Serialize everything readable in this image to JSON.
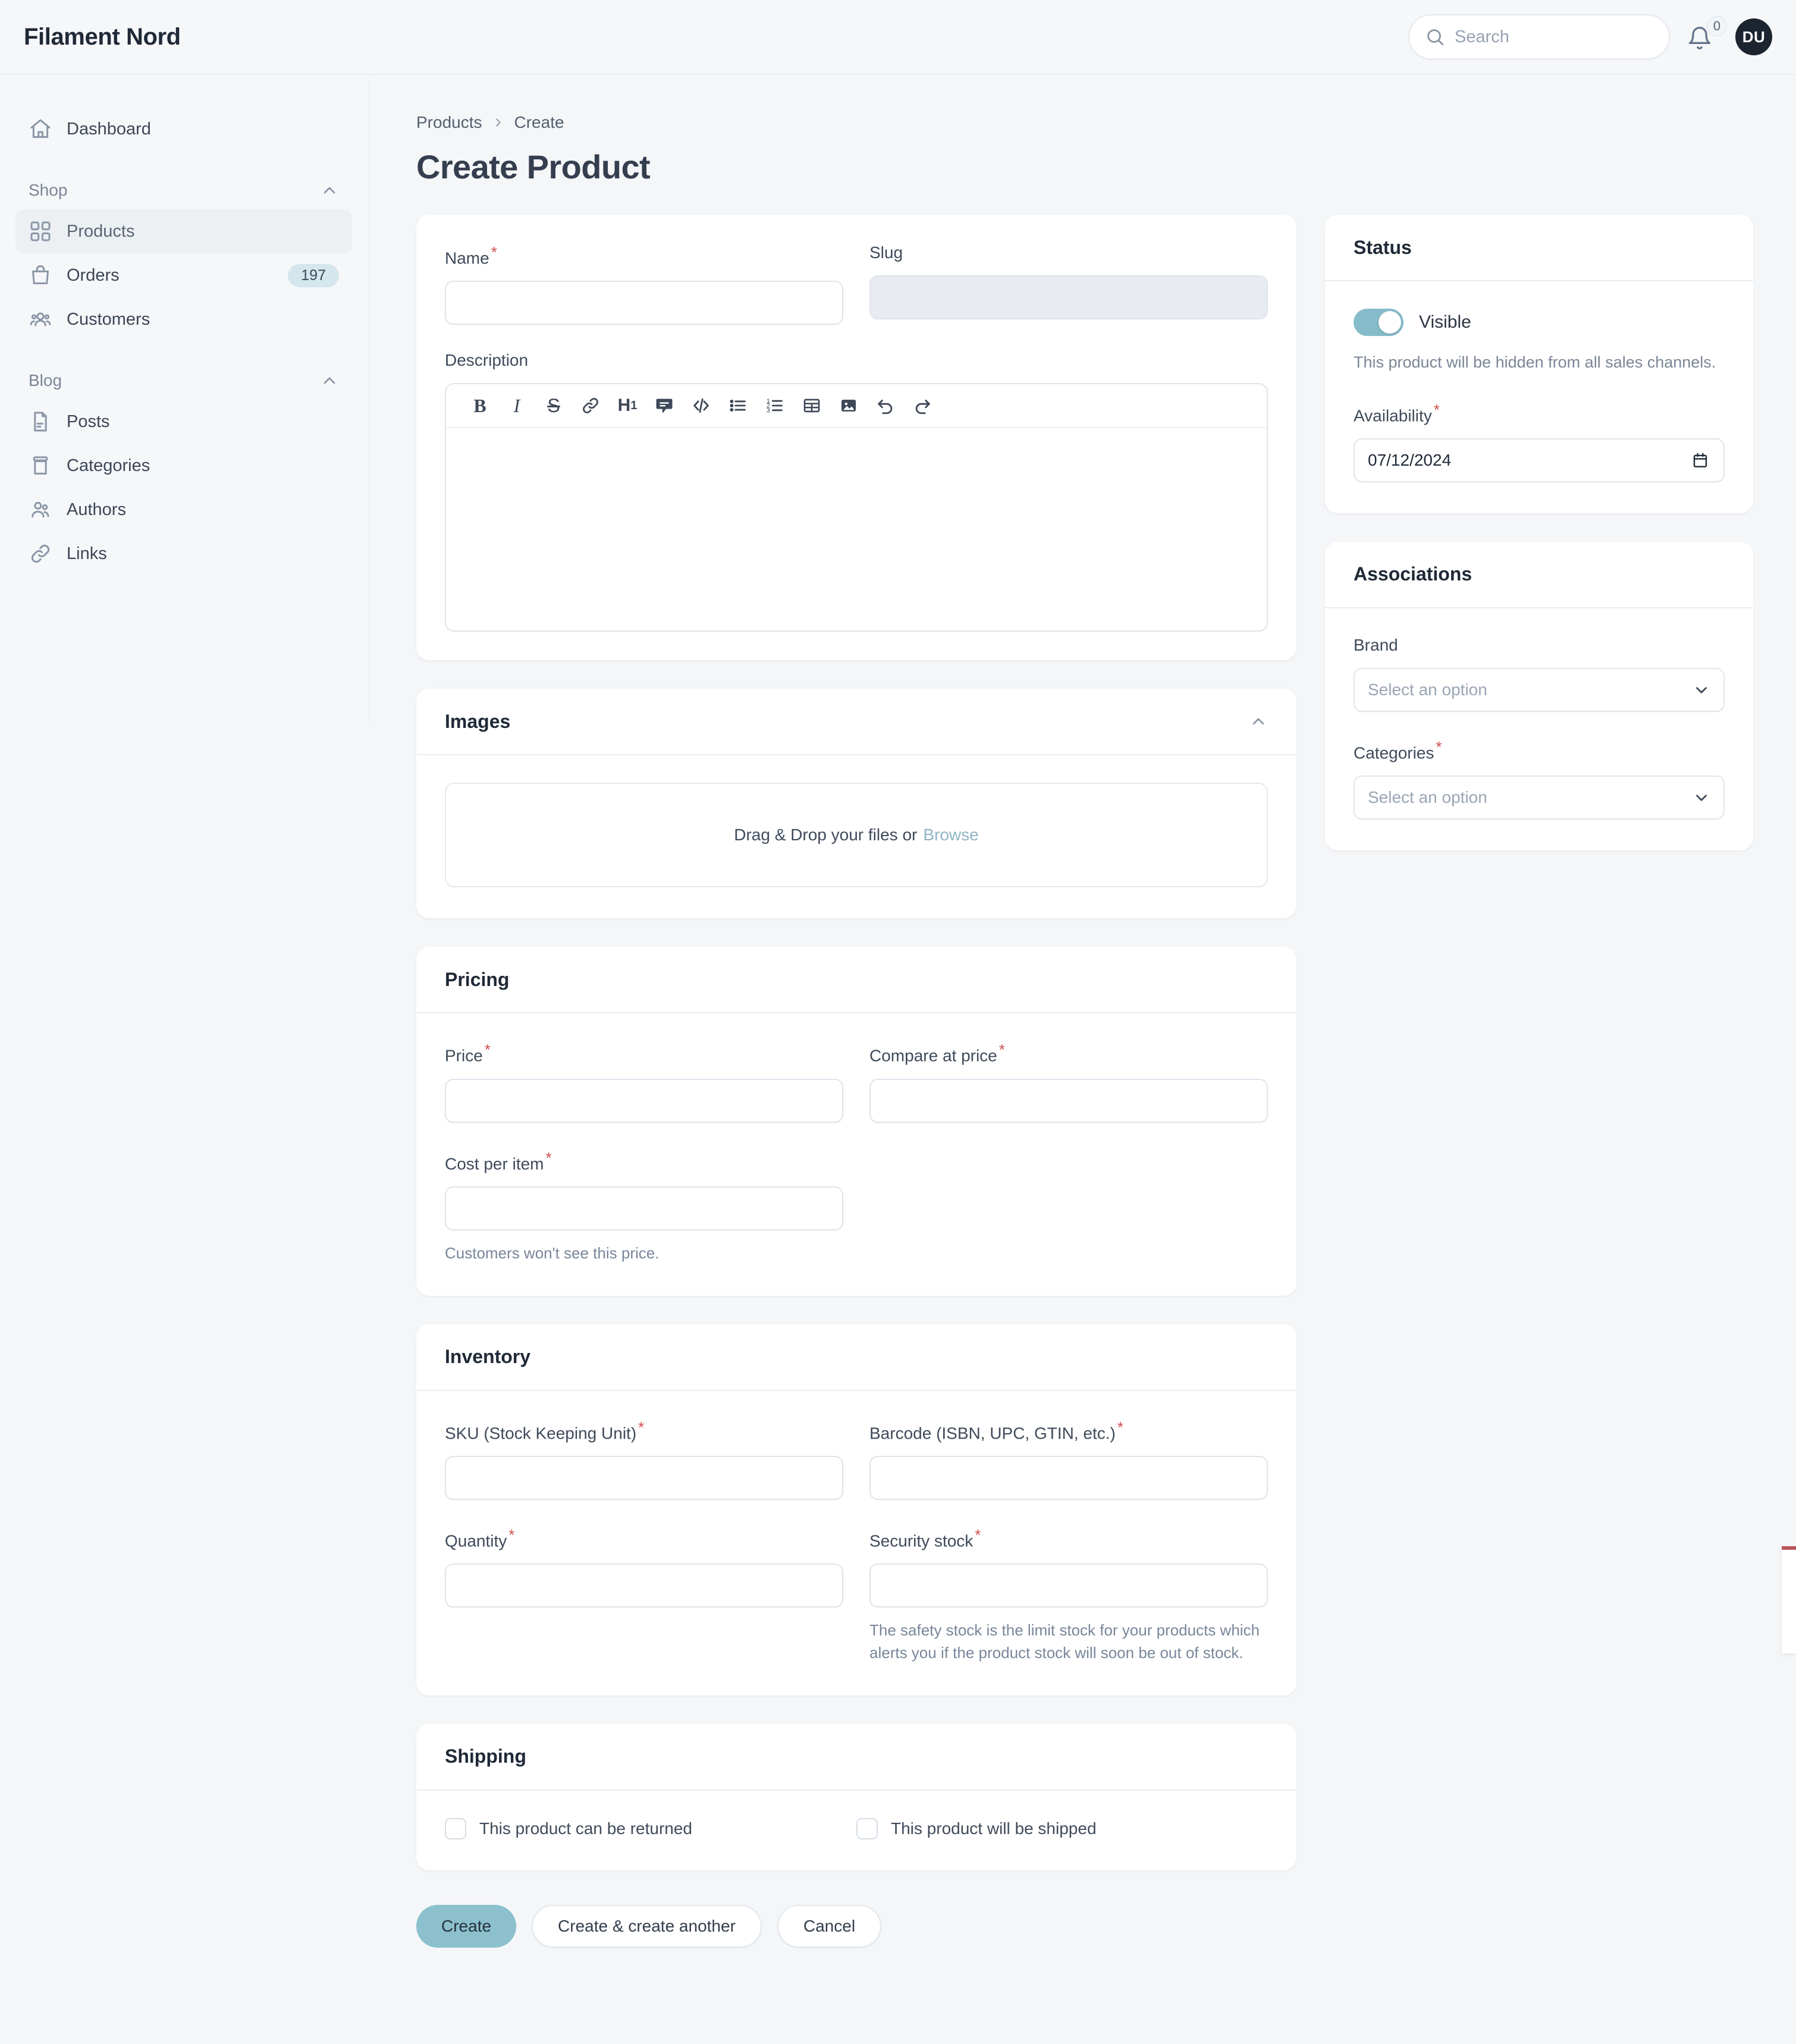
{
  "app": {
    "brand": "Filament Nord"
  },
  "topbar": {
    "search_placeholder": "Search",
    "search_value": "",
    "notification_count": "0",
    "avatar_initials": "DU"
  },
  "sidebar": {
    "dashboard": {
      "label": "Dashboard",
      "icon": "home-icon"
    },
    "groups": [
      {
        "title": "Shop",
        "items": [
          {
            "label": "Products",
            "icon": "grid-icon",
            "badge": "",
            "active": true
          },
          {
            "label": "Orders",
            "icon": "shopping-bag-icon",
            "badge": "197",
            "active": false
          },
          {
            "label": "Customers",
            "icon": "users-icon",
            "badge": "",
            "active": false
          }
        ]
      },
      {
        "title": "Blog",
        "items": [
          {
            "label": "Posts",
            "icon": "document-icon",
            "badge": "",
            "active": false
          },
          {
            "label": "Categories",
            "icon": "archive-icon",
            "badge": "",
            "active": false
          },
          {
            "label": "Authors",
            "icon": "user-group-icon",
            "badge": "",
            "active": false
          },
          {
            "label": "Links",
            "icon": "link-icon",
            "badge": "",
            "active": false
          }
        ]
      }
    ]
  },
  "breadcrumb": {
    "parent": "Products",
    "current": "Create"
  },
  "page": {
    "title": "Create Product"
  },
  "details_card": {
    "name_label": "Name",
    "name_required": "*",
    "name_value": "",
    "slug_label": "Slug",
    "slug_value": "",
    "description_label": "Description",
    "description_value": "",
    "toolbar": [
      {
        "name": "bold-icon",
        "glyph": "B"
      },
      {
        "name": "italic-icon",
        "glyph": "I"
      },
      {
        "name": "strikethrough-icon",
        "glyph": "S"
      },
      {
        "name": "link-icon",
        "glyph": ""
      },
      {
        "name": "heading-1-icon",
        "glyph": "H1"
      },
      {
        "name": "blockquote-icon",
        "glyph": ""
      },
      {
        "name": "code-block-icon",
        "glyph": ""
      },
      {
        "name": "bullet-list-icon",
        "glyph": ""
      },
      {
        "name": "ordered-list-icon",
        "glyph": ""
      },
      {
        "name": "table-icon",
        "glyph": ""
      },
      {
        "name": "image-icon",
        "glyph": ""
      },
      {
        "name": "undo-icon",
        "glyph": ""
      },
      {
        "name": "redo-icon",
        "glyph": ""
      }
    ]
  },
  "images_card": {
    "title": "Images",
    "dropzone_text": "Drag & Drop your files or",
    "browse_label": "Browse"
  },
  "pricing_card": {
    "title": "Pricing",
    "price_label": "Price",
    "price_required": "*",
    "price_value": "",
    "compare_label": "Compare at price",
    "compare_required": "*",
    "compare_value": "",
    "cost_label": "Cost per item",
    "cost_required": "*",
    "cost_value": "",
    "cost_hint": "Customers won't see this price."
  },
  "inventory_card": {
    "title": "Inventory",
    "sku_label": "SKU (Stock Keeping Unit)",
    "sku_required": "*",
    "sku_value": "",
    "barcode_label": "Barcode (ISBN, UPC, GTIN, etc.)",
    "barcode_required": "*",
    "barcode_value": "",
    "quantity_label": "Quantity",
    "quantity_required": "*",
    "quantity_value": "",
    "security_label": "Security stock",
    "security_required": "*",
    "security_value": "",
    "security_hint": "The safety stock is the limit stock for your products which alerts you if the product stock will soon be out of stock."
  },
  "shipping_card": {
    "title": "Shipping",
    "returnable_label": "This product can be returned",
    "returnable_checked": false,
    "shippable_label": "This product will be shipped",
    "shippable_checked": false
  },
  "status_card": {
    "title": "Status",
    "visible_label": "Visible",
    "visible_on": true,
    "visible_hint": "This product will be hidden from all sales channels.",
    "availability_label": "Availability",
    "availability_required": "*",
    "availability_value": "07/12/2024"
  },
  "associations_card": {
    "title": "Associations",
    "brand_label": "Brand",
    "brand_value": "Select an option",
    "categories_label": "Categories",
    "categories_required": "*",
    "categories_value": "Select an option"
  },
  "actions": {
    "create_label": "Create",
    "create_another_label": "Create & create another",
    "cancel_label": "Cancel"
  },
  "colors": {
    "accent": "#8cc0cd",
    "badge_bg": "#d4e7ec",
    "required": "#d14f4f",
    "page_bg": "#f4f6f8"
  }
}
